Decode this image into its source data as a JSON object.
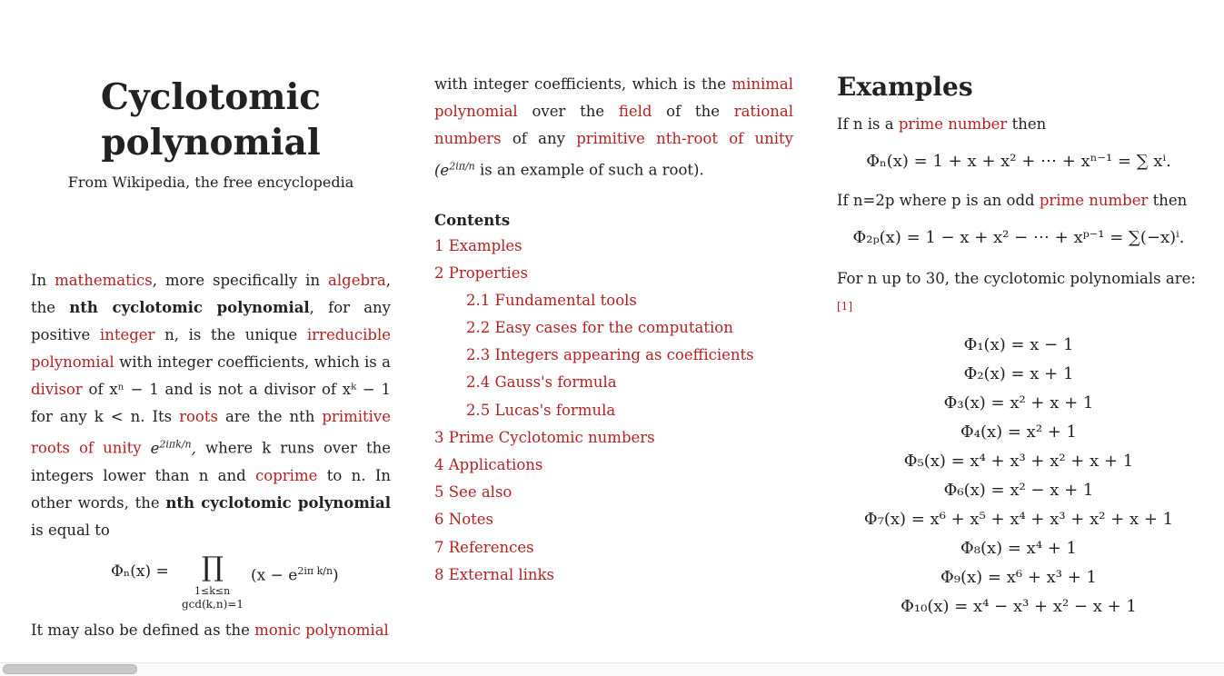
{
  "article": {
    "title_line1": "Cyclotomic",
    "title_line2": "polynomial",
    "subtitle": "From Wikipedia, the free encyclopedia"
  },
  "intro": {
    "t_in": "In",
    "l_mathematics": "mathematics",
    "t_more": ", more specifically in",
    "l_algebra": "algebra",
    "t_the": ", the",
    "b_nth": "nth cyclotomic polynomial",
    "t_forany": ", for any positive",
    "l_integer": "integer",
    "t_n_unique": "n, is the unique",
    "l_irreducible": "irreducible polynomial",
    "t_withint": "with integer coefficients, which is a",
    "l_divisor": "divisor",
    "t_of": "of",
    "t_xn1": "xⁿ − 1 and is not a divisor of xᵏ − 1 for any",
    "t_klt": "k < n. Its",
    "l_roots": "roots",
    "t_arethe": "are the nth",
    "l_primroots": "primitive roots of unity",
    "t_where": "where k runs over the integers lower than n and",
    "l_coprime": "coprime",
    "t_ton": "to n. In other words, the",
    "b_nth2": "nth cyclotomic polynomial",
    "t_isequal": "is equal to",
    "t_also": "It may also be defined as the",
    "l_monic": "monic polynomial",
    "formula_lhs": "Φₙ(x) =",
    "formula_prod": "∏",
    "formula_term": "(x − e",
    "formula_exp": "2iπ k/n",
    "formula_close": ")",
    "formula_under1": "1≤k≤n",
    "formula_under2": "gcd(k,n)=1"
  },
  "col2": {
    "t_withint": "with integer coefficients, which is the",
    "l_minimal": "minimal polynomial",
    "t_over": "over the",
    "l_field": "field",
    "t_ofthe": "of the",
    "l_rational": "rational numbers",
    "t_ofany": "of any",
    "l_primitive": "primitive nth-root of unity",
    "t_exp": "(e",
    "t_expsup": "2iπ/n",
    "t_isan": "is an example of such a root).",
    "contents_label": "Contents",
    "toc": [
      {
        "num": "1",
        "label": "Examples"
      },
      {
        "num": "2",
        "label": "Properties"
      },
      {
        "num": "2.1",
        "label": "Fundamental tools"
      },
      {
        "num": "2.2",
        "label": "Easy cases for the computation"
      },
      {
        "num": "2.3",
        "label": "Integers appearing as coefficients"
      },
      {
        "num": "2.4",
        "label": "Gauss's formula"
      },
      {
        "num": "2.5",
        "label": "Lucas's formula"
      },
      {
        "num": "3",
        "label": "Prime Cyclotomic numbers"
      },
      {
        "num": "4",
        "label": "Applications"
      },
      {
        "num": "5",
        "label": "See also"
      },
      {
        "num": "6",
        "label": "Notes"
      },
      {
        "num": "7",
        "label": "References"
      },
      {
        "num": "8",
        "label": "External links"
      }
    ]
  },
  "examples": {
    "heading": "Examples",
    "t_if": "If n is a",
    "l_prime": "prime number",
    "t_then": "then",
    "eq1": "Φₙ(x) = 1 + x + x² + ⋯ + xⁿ⁻¹ = ∑ xⁱ.",
    "t_if2": "If n=2p where p is an odd",
    "l_prime2": "prime number",
    "t_then2": "then",
    "eq2": "Φ₂ₚ(x) = 1 − x + x² − ⋯ + xᵖ⁻¹ = ∑(−x)ⁱ.",
    "t_upto": "For n up to 30, the cyclotomic polynomials are:",
    "ref": "[1]",
    "polys": [
      "Φ₁(x) = x − 1",
      "Φ₂(x) = x + 1",
      "Φ₃(x) = x² + x + 1",
      "Φ₄(x) = x² + 1",
      "Φ₅(x) = x⁴ + x³ + x² + x + 1",
      "Φ₆(x) = x² − x + 1",
      "Φ₇(x) = x⁶ + x⁵ + x⁴ + x³ + x² + x + 1",
      "Φ₈(x) = x⁴ + 1",
      "Φ₉(x) = x⁶ + x³ + 1",
      "Φ₁₀(x) = x⁴ − x³ + x² − x + 1"
    ]
  }
}
